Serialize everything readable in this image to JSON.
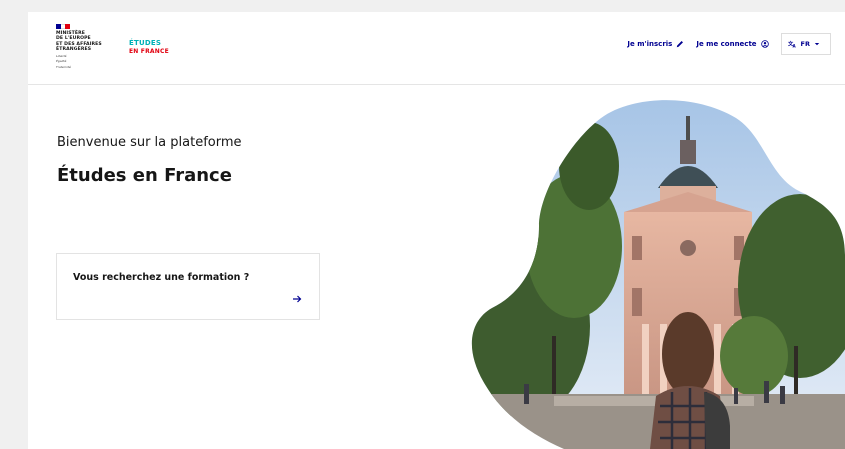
{
  "header": {
    "ministry_lines": [
      "MINISTÈRE",
      "DE L'EUROPE",
      "ET DES AFFAIRES",
      "ÉTRANGÈRES"
    ],
    "motto": [
      "Liberté",
      "Égalité",
      "Fraternité"
    ],
    "logo_line1": "ÉTUDES",
    "logo_line2": "EN FRANCE",
    "register_label": "Je m'inscris",
    "login_label": "Je me connecte",
    "lang_label": "FR"
  },
  "main": {
    "welcome": "Bienvenue sur la plateforme",
    "title": "Études en France",
    "search_label": "Vous recherchez une formation ?"
  },
  "colors": {
    "primary": "#000091",
    "logo_cyan": "#00b1b7",
    "logo_red": "#e1000f"
  },
  "icons": {
    "register": "pencil-icon",
    "login": "user-circle-icon",
    "lang": "translate-icon",
    "search": "arrow-right-icon"
  }
}
